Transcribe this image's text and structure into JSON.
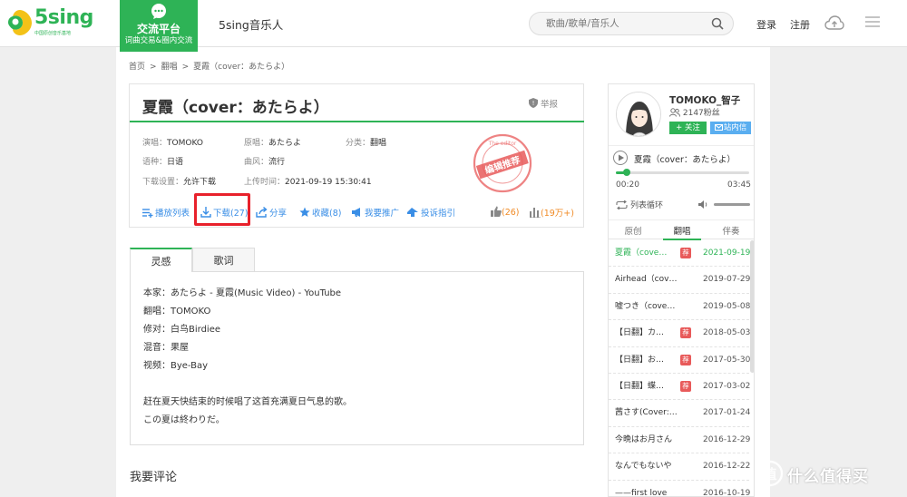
{
  "header": {
    "logo_text": "5sing",
    "logo_subtitle": "中国原创音乐基地",
    "platform_title": "交流平台",
    "platform_subtitle": "词曲交易&圈内交流",
    "musician_link": "5sing音乐人",
    "search_placeholder": "歌曲/歌单/音乐人",
    "login": "登录",
    "register": "注册"
  },
  "breadcrumb": [
    "首页",
    ">",
    "翻唱",
    ">",
    "夏霞（cover：あたらよ）"
  ],
  "song": {
    "title": "夏霞（cover：あたらよ）",
    "report": "举报",
    "meta": [
      {
        "key": "演唱：",
        "value": "TOMOKO"
      },
      {
        "key": "原唱：",
        "value": "あたらよ"
      },
      {
        "key": "分类：",
        "value": "翻唱"
      },
      {
        "key": "语种：",
        "value": "日语"
      },
      {
        "key": "曲风：",
        "value": "流行"
      },
      {
        "key": "下载设置：",
        "value": "允许下载"
      },
      {
        "key": "上传时间：",
        "value": "2021-09-19 15:30:41"
      }
    ],
    "stamp_text": "编辑推荐",
    "stamp_ring": "The editor"
  },
  "actions": {
    "playlist": "播放列表",
    "download": "下载(27)",
    "share": "分享",
    "collect": "收藏(8)",
    "promote": "我要推广",
    "complain": "投诉指引",
    "likes": "(26)",
    "plays": "(19万+)"
  },
  "tabs": [
    "灵感",
    "歌词"
  ],
  "inspiration": [
    "本家：あたらよ - 夏霞(Music Video) - YouTube",
    "翻唱：TOMOKO",
    "修对：白鸟Birdiee",
    "混音：果屋",
    "视频：Bye-Bay",
    "",
    "赶在夏天快结束的时候唱了这首充满夏日气息的歌。",
    "この夏は終わりだ。"
  ],
  "comment_heading": "我要评论",
  "user": {
    "name": "TOMOKO_智子",
    "fans": "2147粉丝",
    "follow": "+ 关注",
    "message": "站内信"
  },
  "player": {
    "track": "夏霞（cover：あたらよ）",
    "progress": 0.08,
    "time_current": "00:20",
    "time_total": "03:45",
    "loop_mode": "列表循环"
  },
  "song_tabs": [
    "原创",
    "翻唱",
    "伴奏"
  ],
  "songs": [
    {
      "name": "夏霞（cover：あたらよ）",
      "date": "2021-09-19",
      "badge": "荐",
      "active": true
    },
    {
      "name": "Airhead（cover：初...",
      "date": "2019-07-29",
      "badge": "",
      "active": false
    },
    {
      "name": "嘘つき（cover：阿部...",
      "date": "2019-05-08",
      "badge": "",
      "active": false
    },
    {
      "name": "【日翻】カタオ...",
      "date": "2018-05-03",
      "badge": "荐",
      "active": false
    },
    {
      "name": "【日翻】おとな...",
      "date": "2017-05-30",
      "badge": "荐",
      "active": false
    },
    {
      "name": "【日翻】蝶々結...",
      "date": "2017-03-02",
      "badge": "荐",
      "active": false
    },
    {
      "name": "茜さす(Cover:Aimer)",
      "date": "2017-01-24",
      "badge": "",
      "active": false
    },
    {
      "name": "今晩はお月さん",
      "date": "2016-12-29",
      "badge": "",
      "active": false
    },
    {
      "name": "なんでもないや",
      "date": "2016-12-22",
      "badge": "",
      "active": false
    },
    {
      "name": "——first love",
      "date": "2016-10-19",
      "badge": "",
      "active": false
    }
  ],
  "watermark": "什么值得买",
  "colors": {
    "brand_green": "#2eb356",
    "link_blue": "#3a8ee6",
    "highlight_red": "#e8212b",
    "vote_orange": "#f08a24"
  }
}
